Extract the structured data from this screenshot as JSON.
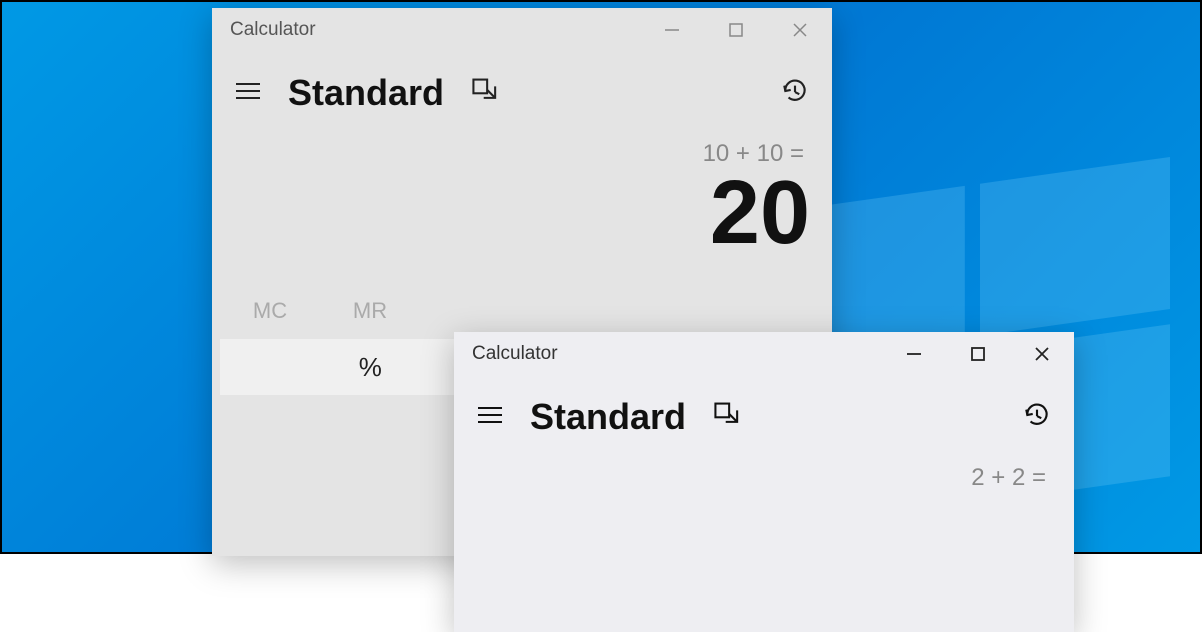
{
  "window_back": {
    "title": "Calculator",
    "mode": "Standard",
    "expression": "10 + 10 =",
    "result": "20",
    "memory": {
      "mc": "MC",
      "mr": "MR"
    },
    "percent": "%"
  },
  "window_front": {
    "title": "Calculator",
    "mode": "Standard",
    "expression": "2 + 2 ="
  }
}
